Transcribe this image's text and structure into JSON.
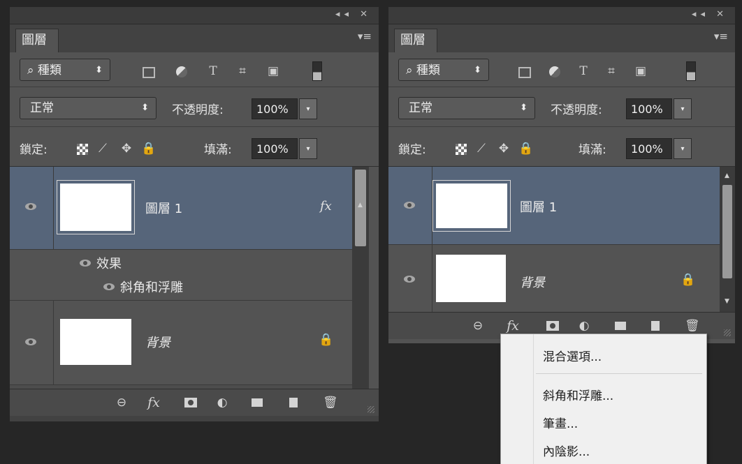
{
  "panel_title": "圖層",
  "window_controls": "◂◂  ✕",
  "panel_menu_icon": "▾≡",
  "filter": {
    "kind_label": "⌕ 種類",
    "select_arrow": "⬍"
  },
  "blend_mode": "正常",
  "opacity_label": "不透明度:",
  "opacity_value": "100%",
  "lock_label": "鎖定:",
  "fill_label": "填滿:",
  "fill_value": "100%",
  "dropdown_glyph": "▾",
  "left_panel": {
    "layers": [
      {
        "name": "圖層 1",
        "selected": true,
        "fx_glyph": "fx"
      },
      {
        "name": "背景",
        "locked": true
      }
    ],
    "effects_label": "效果",
    "effect_items": [
      "斜角和浮雕"
    ]
  },
  "right_panel": {
    "layers": [
      {
        "name": "圖層 1",
        "selected": true
      },
      {
        "name": "背景",
        "locked": true
      }
    ]
  },
  "bottom_bar": {
    "link": "⊖",
    "fx": "fx",
    "adjust": "◐",
    "delete": "🗑"
  },
  "context_menu": {
    "items": [
      "混合選項...",
      "斜角和浮雕...",
      "筆畫...",
      "內陰影..."
    ]
  },
  "colors": {
    "panel": "#535353",
    "selected_layer": "#56657a",
    "background": "#262626",
    "menu": "#f0f0f0"
  }
}
